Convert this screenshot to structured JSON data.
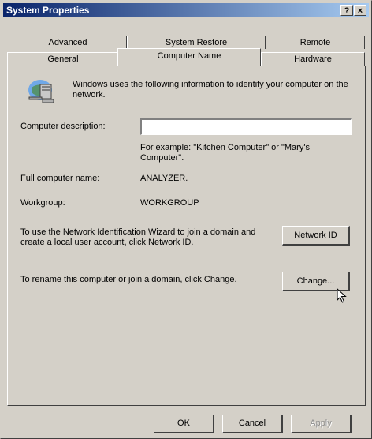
{
  "window": {
    "title": "System Properties",
    "help_button": "?",
    "close_button": "×"
  },
  "tabs": {
    "row_back": [
      "Advanced",
      "System Restore",
      "Remote"
    ],
    "row_front": [
      "General",
      "Computer Name",
      "Hardware"
    ],
    "active": "Computer Name"
  },
  "panel": {
    "intro": "Windows uses the following information to identify your computer on the network.",
    "description_label": "Computer description:",
    "description_value": "",
    "example": "For example: \"Kitchen Computer\" or \"Mary's Computer\".",
    "full_name_label": "Full computer name:",
    "full_name_value": "ANALYZER.",
    "workgroup_label": "Workgroup:",
    "workgroup_value": "WORKGROUP",
    "wizard_text": "To use the Network Identification Wizard to join a domain and create a local user account, click Network ID.",
    "network_id_button": "Network ID",
    "rename_text": "To rename this computer or join a domain, click Change.",
    "change_button": "Change..."
  },
  "footer": {
    "ok": "OK",
    "cancel": "Cancel",
    "apply": "Apply"
  },
  "icons": {
    "computer": "computer-network-icon",
    "cursor": "mouse-cursor-icon"
  }
}
